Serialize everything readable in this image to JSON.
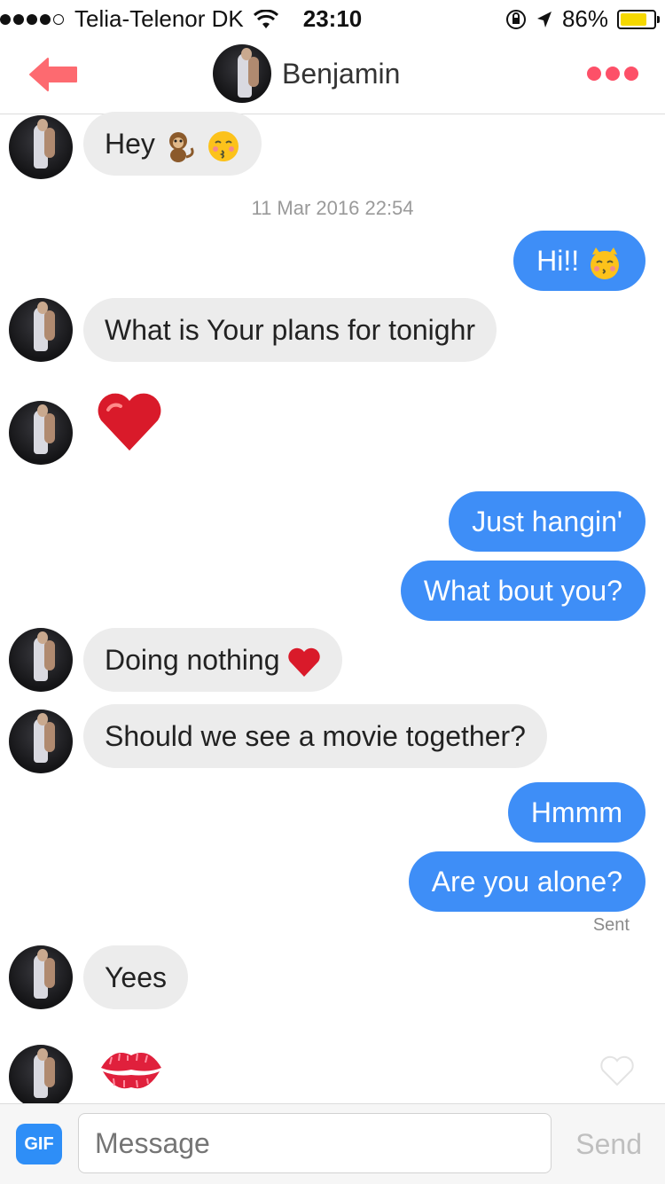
{
  "status_bar": {
    "carrier": "Telia-Telenor DK",
    "time": "23:10",
    "battery_percent": "86%",
    "battery_level": 0.86,
    "signal_filled": 4,
    "signal_total": 5
  },
  "header": {
    "contact_name": "Benjamin",
    "accent_color": "#fd5068"
  },
  "messages": {
    "m1": "Hey",
    "timestamp": "11 Mar 2016 22:54",
    "m2": "Hi!!",
    "m3": "What is Your plans for tonighr",
    "m5": "Just hangin'",
    "m6": "What bout you?",
    "m7": "Doing nothing",
    "m8": "Should we see a movie together?",
    "m9": "Hmmm",
    "m10": "Are you alone?",
    "sent_status": "Sent",
    "m11": "Yees"
  },
  "input_bar": {
    "gif_label": "GIF",
    "placeholder": "Message",
    "send_label": "Send"
  },
  "colors": {
    "outgoing_bubble": "#3e8ef7",
    "incoming_bubble": "#ececec"
  }
}
